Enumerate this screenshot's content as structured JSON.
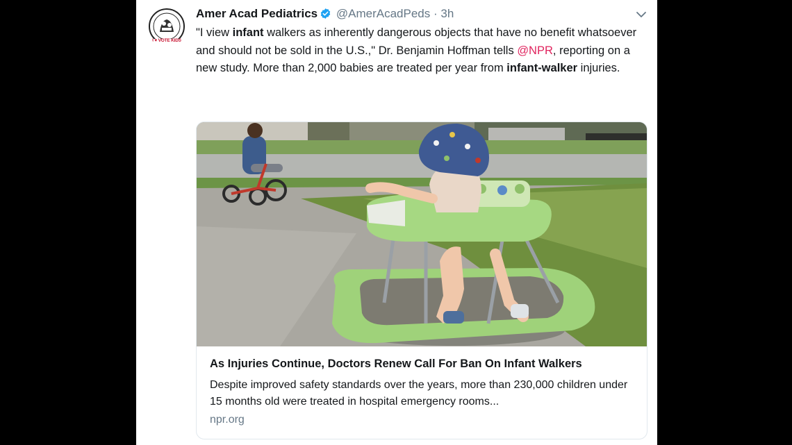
{
  "tweet": {
    "author_name": "Amer Acad Pediatrics",
    "handle": "@AmerAcadPeds",
    "separator": "·",
    "time": "3h",
    "avatar_badge": "I ♥ VOTE KIDS",
    "text": {
      "p1": "\"I view ",
      "b1": "infant",
      "p2": " walkers as inherently dangerous objects that have no benefit whatsoever and should not be sold in the U.S.,\" Dr. Benjamin Hoffman tells ",
      "mention": "@NPR",
      "p3": ", reporting on a new study. More than 2,000 babies are treated per year from ",
      "b2": "infant-walker",
      "p4": " injuries."
    }
  },
  "card": {
    "title": "As Injuries Continue, Doctors Renew Call For Ban On Infant Walkers",
    "description": "Despite improved safety standards over the years, more than 230,000 children under 15 months old were treated in hospital emergency rooms...",
    "domain": "npr.org"
  },
  "icons": {
    "verified": "verified-badge-icon",
    "caret": "chevron-down-icon"
  },
  "colors": {
    "name": "#14171a",
    "handle": "#657786",
    "mention": "#e0245e",
    "verified": "#1da1f2",
    "walker_green": "#9fd27a"
  }
}
